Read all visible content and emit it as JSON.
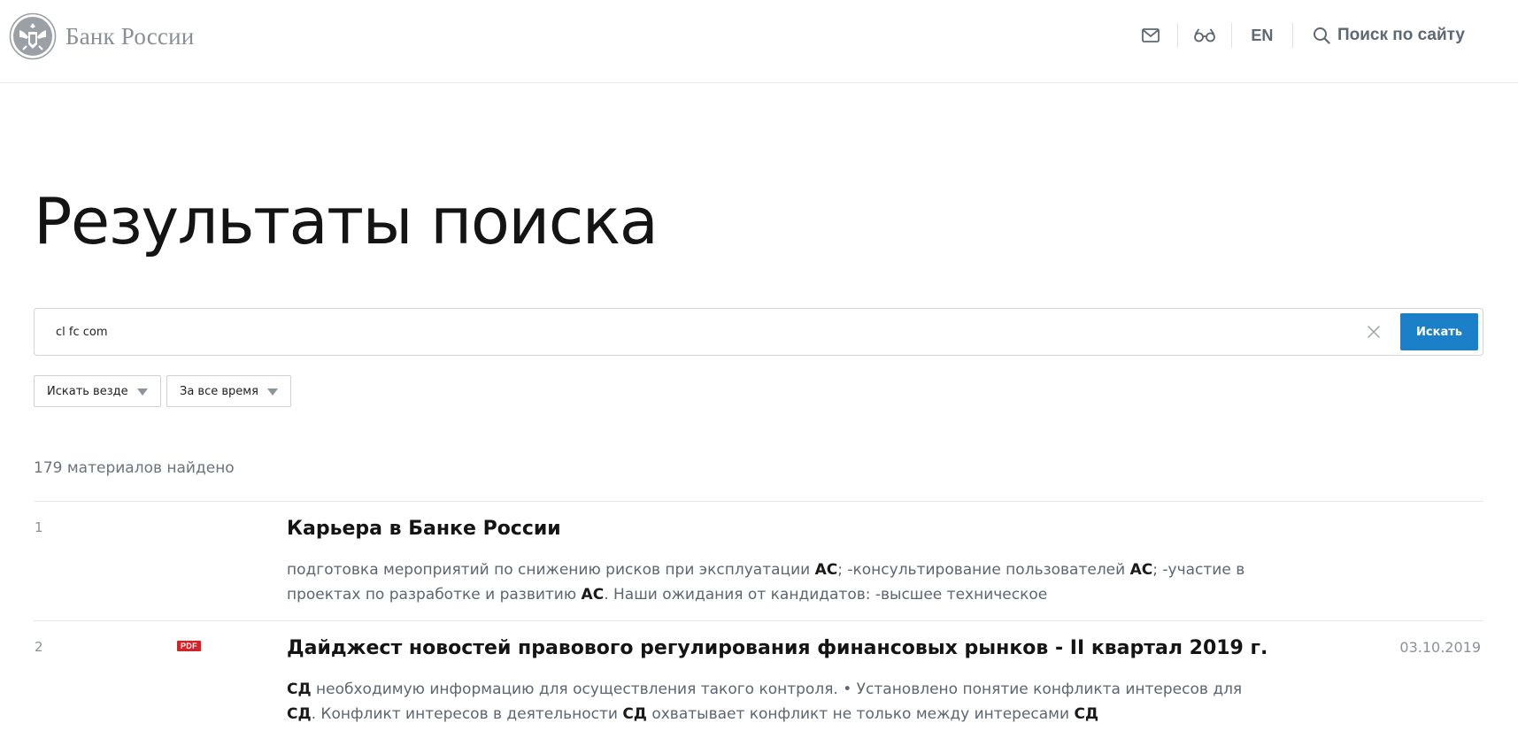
{
  "header": {
    "logo_text": "Банк России",
    "lang": "EN",
    "search_label": "Поиск по сайту",
    "icons": [
      "emblem-icon",
      "mail-icon",
      "glasses-icon",
      "search-icon"
    ]
  },
  "page": {
    "title": "Результаты поиска"
  },
  "search": {
    "value": "cl fc com",
    "submit_label": "Искать"
  },
  "filters": [
    {
      "label": "Искать везде"
    },
    {
      "label": "За все время"
    }
  ],
  "results_count": "179 материалов найдено",
  "results": [
    {
      "number": "1",
      "title": "Карьера в Банке России",
      "snippet_parts": [
        [
          "подготовка мероприятий по снижению рисков при эксплуатации ",
          false
        ],
        [
          "АС",
          true
        ],
        [
          "; -консультирование пользователей ",
          false
        ],
        [
          "АС",
          true
        ],
        [
          "; -участие в проектах по разработке и развитию ",
          false
        ],
        [
          "АС",
          true
        ],
        [
          ". Наши ожидания от кандидатов: -высшее техническое",
          false
        ]
      ]
    },
    {
      "number": "2",
      "badge": "PDF",
      "title": "Дайджест новостей правового регулирования финансовых рынков - II квартал 2019 г.",
      "date": "03.10.2019",
      "snippet_parts": [
        [
          "СД",
          true
        ],
        [
          " необходимую информацию для осуществления такого контроля. • Установлено понятие конфликта интересов для ",
          false
        ],
        [
          "СД",
          true
        ],
        [
          ". Конфликт интересов в деятельности ",
          false
        ],
        [
          "СД",
          true
        ],
        [
          " охватывает конфликт не только между интересами ",
          false
        ],
        [
          "СД",
          true
        ]
      ]
    }
  ],
  "colors": {
    "accent": "#1b80c7",
    "pdf_badge": "#d6232a",
    "muted_text": "#5d6670",
    "title_text": "#141414"
  }
}
